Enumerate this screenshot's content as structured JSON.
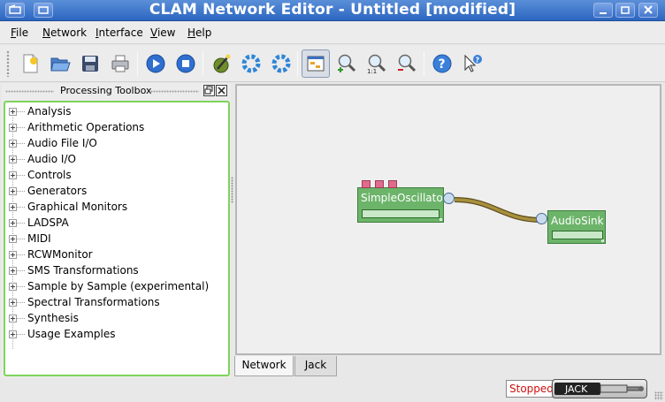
{
  "window": {
    "title": "CLAM Network Editor - Untitled [modified]"
  },
  "menu": [
    {
      "label": "File",
      "mnemonic": "F",
      "rest": "ile"
    },
    {
      "label": "Network",
      "mnemonic": "N",
      "rest": "etwork"
    },
    {
      "label": "Interface",
      "mnemonic": "I",
      "rest": "nterface"
    },
    {
      "label": "View",
      "mnemonic": "V",
      "rest": "iew"
    },
    {
      "label": "Help",
      "mnemonic": "H",
      "rest": "elp"
    }
  ],
  "toolbar": {
    "icons": [
      "new-document-icon",
      "open-folder-icon",
      "save-icon",
      "print-icon",
      "play-icon",
      "stop-icon",
      "embed-wizard-icon",
      "configure-gear-icon",
      "configure-gear-alt-icon",
      "fit-view-icon",
      "zoom-in-icon",
      "zoom-reset-icon",
      "zoom-out-icon",
      "help-icon",
      "whats-this-icon"
    ]
  },
  "dock": {
    "title": "Processing Toolbox",
    "items": [
      "Analysis",
      "Arithmetic Operations",
      "Audio File I/O",
      "Audio I/O",
      "Controls",
      "Generators",
      "Graphical Monitors",
      "LADSPA",
      "MIDI",
      "RCWMonitor",
      "SMS Transformations",
      "Sample by Sample (experimental)",
      "Spectral Transformations",
      "Synthesis",
      "Usage Examples"
    ]
  },
  "canvas": {
    "processings": [
      {
        "name": "SimpleOscillator"
      },
      {
        "name": "AudioSink"
      }
    ]
  },
  "tabs": [
    {
      "label": "Network",
      "active": true
    },
    {
      "label": "Jack",
      "active": false
    }
  ],
  "status": {
    "state": "Stopped",
    "backend_logo": "JACK"
  },
  "colors": {
    "titlebar": "#2c66c0",
    "processing_box": "#6cb46a",
    "connection": "#8b7430",
    "control_port": "#e06b8a",
    "stopped_text": "#d01010",
    "tree_focus_border": "#7dd45a"
  }
}
